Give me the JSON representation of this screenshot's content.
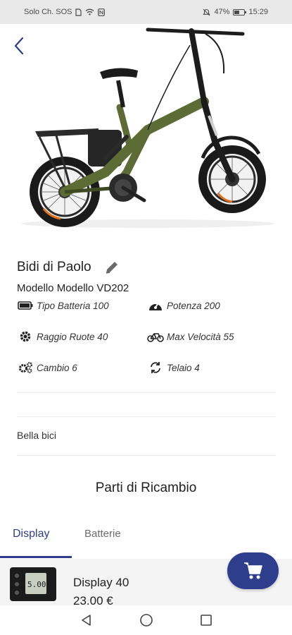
{
  "status_bar": {
    "carrier": "Solo Ch. SOS",
    "battery": "47%",
    "battery_level": 0.47,
    "time": "15:29"
  },
  "header": {
    "back_icon": "chevron-left-icon"
  },
  "bike": {
    "owner_name": "Bidi di Paolo",
    "model": "Modello Modello VD202",
    "specs": [
      {
        "icon": "battery-icon",
        "label": "Tipo Batteria 100"
      },
      {
        "icon": "speedometer-icon",
        "label": "Potenza 200"
      },
      {
        "icon": "gear-icon",
        "label": "Raggio Ruote 40"
      },
      {
        "icon": "bicycle-icon",
        "label": "Max Velocità 55"
      },
      {
        "icon": "gears-icon",
        "label": "Cambio 6"
      },
      {
        "icon": "sync-icon",
        "label": "Telaio 4"
      }
    ],
    "description": "Bella bici"
  },
  "spare_parts": {
    "title": "Parti di Ricambio",
    "tabs": [
      {
        "label": "Display",
        "active": true
      },
      {
        "label": "Batterie",
        "active": false
      }
    ],
    "items": [
      {
        "name": "Display 40",
        "price": "23.00 €"
      }
    ]
  },
  "colors": {
    "accent": "#2e3e8d",
    "frame_green": "#5d6b34",
    "status_bar_bg": "#e9e9e9"
  }
}
